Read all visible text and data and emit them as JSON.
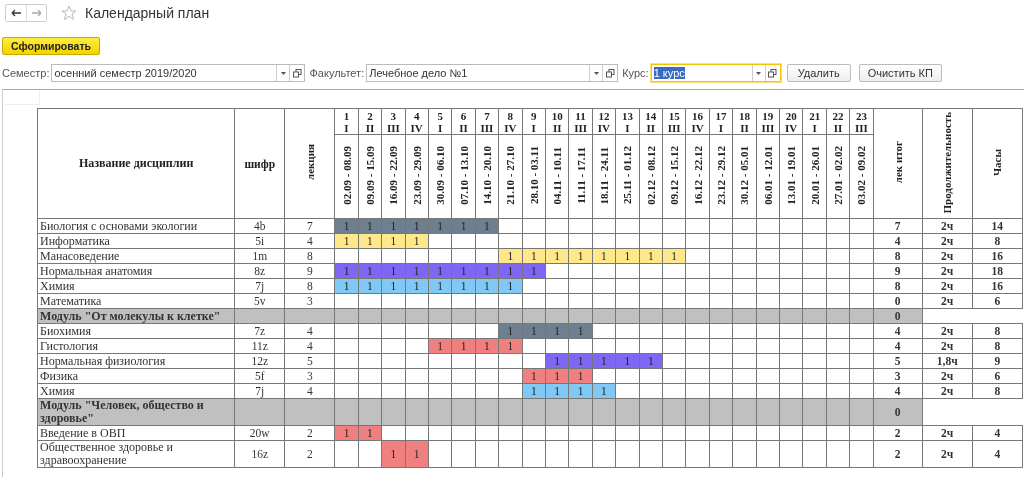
{
  "window": {
    "title": "Календарный план"
  },
  "generate_button": "Сформировать",
  "filters": [
    {
      "label": "Семестр:",
      "value": "осенний семестр 2019/2020",
      "focused": false
    },
    {
      "label": "Факультет:",
      "value": "Лечебное дело №1",
      "focused": false
    },
    {
      "label": "Курс:",
      "value": "1 курс",
      "focused": true
    }
  ],
  "buttons": [
    "Удалить",
    "Очистить КП"
  ],
  "table": {
    "headers": {
      "name": "Название дисциплин",
      "code": "шифр",
      "lectures": "лекция",
      "total": "лек итог",
      "duration": "Продолжительность",
      "hours": "Часы"
    },
    "weeks": [
      {
        "num": "1",
        "roman": "I",
        "dates": "02.09 - 08.09"
      },
      {
        "num": "2",
        "roman": "II",
        "dates": "09.09 - 15.09"
      },
      {
        "num": "3",
        "roman": "III",
        "dates": "16.09 - 22.09"
      },
      {
        "num": "4",
        "roman": "IV",
        "dates": "23.09 - 29.09"
      },
      {
        "num": "5",
        "roman": "I",
        "dates": "30.09 - 06.10"
      },
      {
        "num": "6",
        "roman": "II",
        "dates": "07.10 - 13.10"
      },
      {
        "num": "7",
        "roman": "III",
        "dates": "14.10 - 20.10"
      },
      {
        "num": "8",
        "roman": "IV",
        "dates": "21.10 - 27.10"
      },
      {
        "num": "9",
        "roman": "I",
        "dates": "28.10 - 03.11"
      },
      {
        "num": "10",
        "roman": "II",
        "dates": "04.11 - 10.11"
      },
      {
        "num": "11",
        "roman": "III",
        "dates": "11.11 - 17.11"
      },
      {
        "num": "12",
        "roman": "IV",
        "dates": "18.11 - 24.11"
      },
      {
        "num": "13",
        "roman": "I",
        "dates": "25.11 - 01.12"
      },
      {
        "num": "14",
        "roman": "II",
        "dates": "02.12 - 08.12"
      },
      {
        "num": "15",
        "roman": "III",
        "dates": "09.12 - 15.12"
      },
      {
        "num": "16",
        "roman": "IV",
        "dates": "16.12 - 22.12"
      },
      {
        "num": "17",
        "roman": "I",
        "dates": "23.12 - 29.12"
      },
      {
        "num": "18",
        "roman": "II",
        "dates": "30.12 - 05.01"
      },
      {
        "num": "19",
        "roman": "III",
        "dates": "06.01 - 12.01"
      },
      {
        "num": "20",
        "roman": "IV",
        "dates": "13.01 - 19.01"
      },
      {
        "num": "21",
        "roman": "I",
        "dates": "20.01 - 26.01"
      },
      {
        "num": "22",
        "roman": "II",
        "dates": "27.01 - 02.02"
      },
      {
        "num": "23",
        "roman": "III",
        "dates": "03.02 - 09.02"
      }
    ],
    "rows": [
      {
        "kind": "discipline",
        "name": "Биология с основами экологии",
        "code": "4b",
        "lectures": "7",
        "color": "#6e7f8f",
        "cells": [
          "1",
          "1",
          "1",
          "1",
          "1",
          "1",
          "1",
          null,
          null,
          null,
          null,
          null,
          null,
          null,
          null,
          null,
          null,
          null,
          null,
          null,
          null,
          null,
          null
        ],
        "total": "7",
        "duration": "2ч",
        "hours": "14"
      },
      {
        "kind": "discipline",
        "name": "Информатика",
        "code": "5i",
        "lectures": "4",
        "color": "#ffe88a",
        "cells": [
          "1",
          "1",
          "1",
          "1",
          null,
          null,
          null,
          null,
          null,
          null,
          null,
          null,
          null,
          null,
          null,
          null,
          null,
          null,
          null,
          null,
          null,
          null,
          null
        ],
        "total": "4",
        "duration": "2ч",
        "hours": "8"
      },
      {
        "kind": "discipline",
        "name": "Манасоведение",
        "code": "1m",
        "lectures": "8",
        "color": "#ffe88a",
        "cells": [
          null,
          null,
          null,
          null,
          null,
          null,
          null,
          "1",
          "1",
          "1",
          "1",
          "1",
          "1",
          "1",
          "1",
          null,
          null,
          null,
          null,
          null,
          null,
          null,
          null
        ],
        "total": "8",
        "duration": "2ч",
        "hours": "16"
      },
      {
        "kind": "discipline",
        "name": "Нормальная анатомия",
        "code": "8z",
        "lectures": "9",
        "color": "#8066f5",
        "cells": [
          "1",
          "1",
          "1",
          "1",
          "1",
          "1",
          "1",
          "1",
          "1",
          null,
          null,
          null,
          null,
          null,
          null,
          null,
          null,
          null,
          null,
          null,
          null,
          null,
          null
        ],
        "total": "9",
        "duration": "2ч",
        "hours": "18"
      },
      {
        "kind": "discipline",
        "name": "Химия",
        "code": "7j",
        "lectures": "8",
        "color": "#80c8f5",
        "cells": [
          "1",
          "1",
          "1",
          "1",
          "1",
          "1",
          "1",
          "1",
          null,
          null,
          null,
          null,
          null,
          null,
          null,
          null,
          null,
          null,
          null,
          null,
          null,
          null,
          null
        ],
        "total": "8",
        "duration": "2ч",
        "hours": "16"
      },
      {
        "kind": "discipline",
        "name": "Математика",
        "code": "5v",
        "lectures": "3",
        "cells": [
          null,
          null,
          null,
          null,
          null,
          null,
          null,
          null,
          null,
          null,
          null,
          null,
          null,
          null,
          null,
          null,
          null,
          null,
          null,
          null,
          null,
          null,
          null
        ],
        "total": "0",
        "duration": "2ч",
        "hours": "6"
      },
      {
        "kind": "module",
        "name": "Модуль \"От молекулы к клетке\"",
        "total": "0"
      },
      {
        "kind": "discipline",
        "name": "Биохимия",
        "code": "7z",
        "lectures": "4",
        "color": "#6e7f8f",
        "cells": [
          null,
          null,
          null,
          null,
          null,
          null,
          null,
          "1",
          "1",
          "1",
          "1",
          null,
          null,
          null,
          null,
          null,
          null,
          null,
          null,
          null,
          null,
          null,
          null
        ],
        "total": "4",
        "duration": "2ч",
        "hours": "8"
      },
      {
        "kind": "discipline",
        "name": "Гистология",
        "code": "11z",
        "lectures": "4",
        "color": "#f08080",
        "cells": [
          null,
          null,
          null,
          null,
          "1",
          "1",
          "1",
          "1",
          null,
          null,
          null,
          null,
          null,
          null,
          null,
          null,
          null,
          null,
          null,
          null,
          null,
          null,
          null
        ],
        "total": "4",
        "duration": "2ч",
        "hours": "8"
      },
      {
        "kind": "discipline",
        "name": "Нормальная физиология",
        "code": "12z",
        "lectures": "5",
        "color": "#8066f5",
        "cells": [
          null,
          null,
          null,
          null,
          null,
          null,
          null,
          null,
          null,
          "1",
          "1",
          "1",
          "1",
          "1",
          null,
          null,
          null,
          null,
          null,
          null,
          null,
          null,
          null
        ],
        "total": "5",
        "duration": "1,8ч",
        "hours": "9"
      },
      {
        "kind": "discipline",
        "name": "Физика",
        "code": "5f",
        "lectures": "3",
        "color": "#f08080",
        "cells": [
          null,
          null,
          null,
          null,
          null,
          null,
          null,
          null,
          "1",
          "1",
          "1",
          null,
          null,
          null,
          null,
          null,
          null,
          null,
          null,
          null,
          null,
          null,
          null
        ],
        "total": "3",
        "duration": "2ч",
        "hours": "6"
      },
      {
        "kind": "discipline",
        "name": "Химия",
        "code": "7j",
        "lectures": "4",
        "color": "#80c8f5",
        "cells": [
          null,
          null,
          null,
          null,
          null,
          null,
          null,
          null,
          "1",
          "1",
          "1",
          "1",
          null,
          null,
          null,
          null,
          null,
          null,
          null,
          null,
          null,
          null,
          null
        ],
        "total": "4",
        "duration": "2ч",
        "hours": "8"
      },
      {
        "kind": "module",
        "name": "Модуль \"Человек, общество и здоровье\"",
        "total": "0"
      },
      {
        "kind": "discipline",
        "name": "Введение в ОВП",
        "code": "20w",
        "lectures": "2",
        "color": "#f08080",
        "cells": [
          "1",
          "1",
          null,
          null,
          null,
          null,
          null,
          null,
          null,
          null,
          null,
          null,
          null,
          null,
          null,
          null,
          null,
          null,
          null,
          null,
          null,
          null,
          null
        ],
        "total": "2",
        "duration": "2ч",
        "hours": "4"
      },
      {
        "kind": "discipline",
        "name": "Общественное здоровье и здравоохранение",
        "code": "16z",
        "lectures": "2",
        "color": "#f08080",
        "cells": [
          null,
          null,
          "1",
          "1",
          null,
          null,
          null,
          null,
          null,
          null,
          null,
          null,
          null,
          null,
          null,
          null,
          null,
          null,
          null,
          null,
          null,
          null,
          null
        ],
        "total": "2",
        "duration": "2ч",
        "hours": "4"
      }
    ]
  }
}
